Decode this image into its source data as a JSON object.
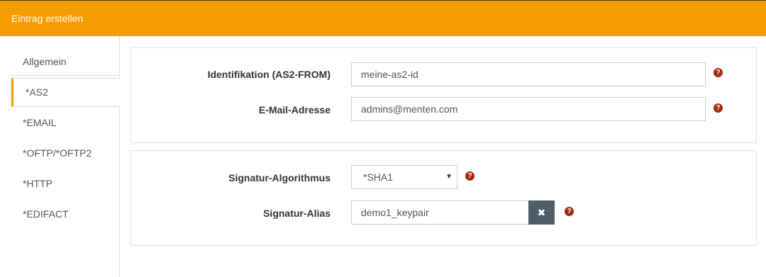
{
  "header": {
    "title": "Eintrag erstellen"
  },
  "tabs": [
    {
      "label": "Allgemein"
    },
    {
      "label": "*AS2"
    },
    {
      "label": "*EMAIL"
    },
    {
      "label": "*OFTP/*OFTP2"
    },
    {
      "label": "*HTTP"
    },
    {
      "label": "*EDIFACT"
    }
  ],
  "active_tab": "*AS2",
  "section1": {
    "identification": {
      "label": "Identifikation (AS2-FROM)",
      "value": "meine-as2-id"
    },
    "email": {
      "label": "E-Mail-Adresse",
      "value": "admins@menten.com"
    }
  },
  "section2": {
    "signature_algorithm": {
      "label": "Signatur-Algorithmus",
      "value": "*SHA1"
    },
    "signature_alias": {
      "label": "Signatur-Alias",
      "value": "demo1_keypair"
    }
  },
  "icons": {
    "help": "question-circle-icon",
    "clear": "close-icon",
    "select": "caret-down-icon"
  },
  "colors": {
    "accent": "#f59c00",
    "help": "#a32a12",
    "button": "#4e5d66"
  }
}
